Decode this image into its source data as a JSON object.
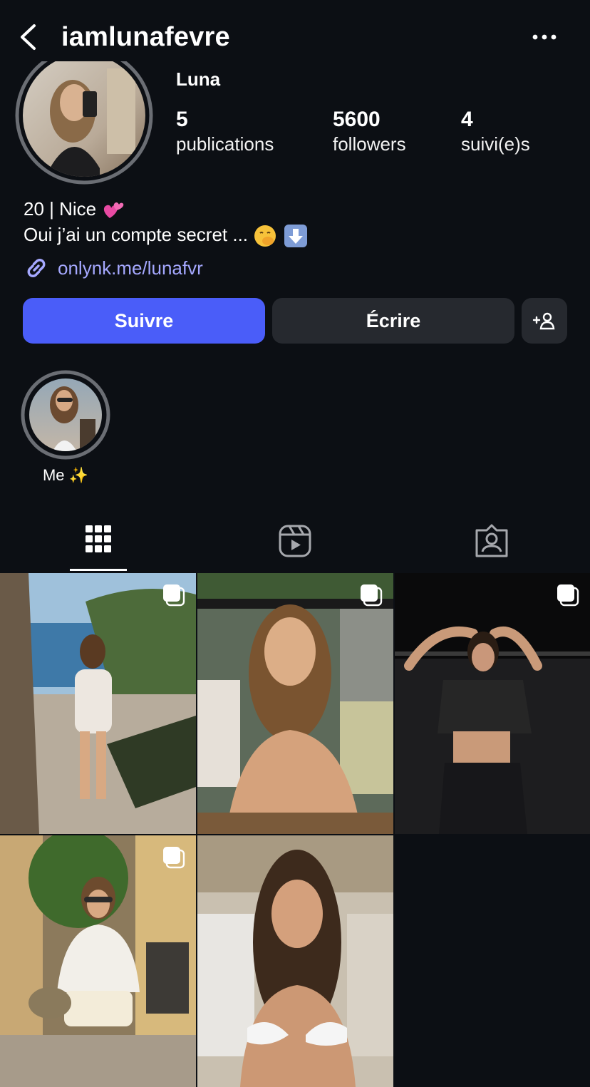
{
  "header": {
    "username": "iamlunafevre"
  },
  "profile": {
    "display_name": "Luna",
    "stats": [
      {
        "value": "5",
        "label": "publications"
      },
      {
        "value": "5600",
        "label": "followers"
      },
      {
        "value": "4",
        "label": "suivi(e)s"
      }
    ],
    "bio_line1": "20 | Nice",
    "bio_line2": "Oui j’ai un compte secret ...",
    "link": "onlynk.me/lunafvr"
  },
  "actions": {
    "follow_label": "Suivre",
    "message_label": "Écrire"
  },
  "highlights": [
    {
      "label": "Me"
    }
  ],
  "tabs": [
    {
      "name": "posts",
      "icon": "grid-icon",
      "active": true
    },
    {
      "name": "reels",
      "icon": "reels-icon",
      "active": false
    },
    {
      "name": "tagged",
      "icon": "tagged-user-icon",
      "active": false
    }
  ],
  "colors": {
    "background": "#0c0f14",
    "accent": "#4a5df9",
    "link": "#a5a8ff",
    "secondary_button": "#26292f"
  }
}
